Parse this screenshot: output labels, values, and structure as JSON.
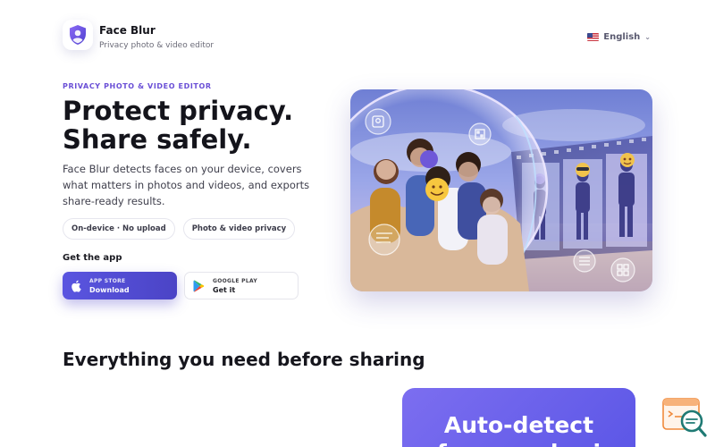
{
  "header": {
    "app_name": "Face Blur",
    "app_subtitle": "Privacy photo & video editor",
    "language": "English",
    "logo_icon": "shield-icon",
    "language_icon": "us-flag-icon"
  },
  "hero": {
    "eyebrow": "PRIVACY PHOTO & VIDEO EDITOR",
    "title_line1": "Protect privacy.",
    "title_line2": "Share safely.",
    "description": "Face Blur detects faces on your device, covers what matters in photos and videos, and exports share-ready results.",
    "chips": [
      "On-device · No upload",
      "Photo & video privacy"
    ],
    "get_app_label": "Get the app",
    "app_store": {
      "small": "APP STORE",
      "big": "Download"
    },
    "google_play": {
      "small": "GOOGLE PLAY",
      "big": "Get it"
    }
  },
  "features": {
    "section_title": "Everything you need before sharing",
    "first_card_title_line1": "Auto-detect",
    "first_card_title_line2": "faces and pri"
  },
  "colors": {
    "accent": "#5a55e0",
    "eyebrow": "#6a4fd6"
  }
}
